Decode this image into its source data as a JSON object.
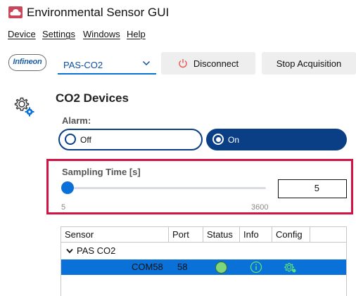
{
  "window": {
    "title": "Environmental Sensor GUI"
  },
  "menu": {
    "items": [
      {
        "label": "Device"
      },
      {
        "label": "Settings"
      },
      {
        "label": "Windows"
      },
      {
        "label": "Help"
      }
    ]
  },
  "toolbar": {
    "logo_text": "Infineon",
    "device_select": {
      "value": "PAS-CO2"
    },
    "disconnect_label": "Disconnect",
    "stop_label": "Stop Acquisition"
  },
  "panel": {
    "title": "CO2 Devices",
    "alarm": {
      "label": "Alarm:",
      "off_label": "Off",
      "on_label": "On",
      "selected": "On"
    },
    "sampling": {
      "label": "Sampling Time [s]",
      "min_label": "5",
      "max_label": "3600",
      "value": "5",
      "slider_min": 5,
      "slider_max": 3600,
      "slider_value": 5
    }
  },
  "table": {
    "columns": [
      "Sensor",
      "Port",
      "Status",
      "Info",
      "Config"
    ],
    "group": {
      "label": "PAS CO2"
    },
    "rows": [
      {
        "sensor": "COM58",
        "port": "58",
        "status": "connected",
        "info": "info-icon",
        "config": "gear-icon"
      }
    ]
  },
  "colors": {
    "accent": "#0a71d8",
    "toggle": "#0a3f85",
    "highlight": "#d21240",
    "status_ok": "#80d67a",
    "brand": "#c8475a"
  }
}
